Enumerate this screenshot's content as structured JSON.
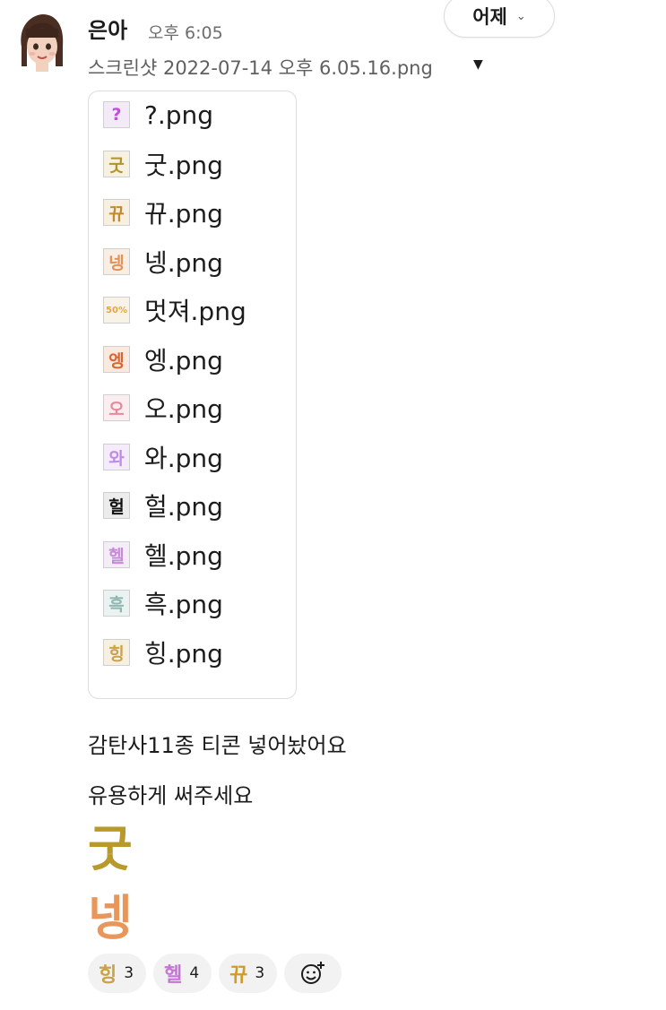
{
  "message": {
    "author": "은아",
    "timestamp": "오후 6:05",
    "date_button": "어제",
    "file_name": "스크린샷 2022-07-14 오후 6.05.16.png",
    "lines": [
      "감탄사11종 티콘 넣어놨어요",
      "유용하게 써주세요"
    ]
  },
  "files": [
    {
      "icon": "?",
      "label": "?.png",
      "color": "#c64be0",
      "bg": "#f2eaf7"
    },
    {
      "icon": "굿",
      "label": "굿.png",
      "color": "#b4922a",
      "bg": "#f6f1e0"
    },
    {
      "icon": "뀨",
      "label": "뀨.png",
      "color": "#c2892e",
      "bg": "#f7efe0"
    },
    {
      "icon": "넹",
      "label": "넹.png",
      "color": "#e0945a",
      "bg": "#f9eee4"
    },
    {
      "icon": "50%",
      "label": "멋져.png",
      "color": "#e2a64a",
      "bg": "#f8f3e6"
    },
    {
      "icon": "엥",
      "label": "엥.png",
      "color": "#d9662e",
      "bg": "#f9e9df"
    },
    {
      "icon": "오",
      "label": "오.png",
      "color": "#e58a9a",
      "bg": "#fbeef0"
    },
    {
      "icon": "와",
      "label": "와.png",
      "color": "#c08ae8",
      "bg": "#f4ecfb"
    },
    {
      "icon": "헐",
      "label": "헐.png",
      "color": "#111111",
      "bg": "#ececec"
    },
    {
      "icon": "헬",
      "label": "헬.png",
      "color": "#c68ad8",
      "bg": "#f4ecf7"
    },
    {
      "icon": "흑",
      "label": "흑.png",
      "color": "#8fb6b0",
      "bg": "#ebf3f2"
    },
    {
      "icon": "힝",
      "label": "힝.png",
      "color": "#c9a24a",
      "bg": "#f6f0e2"
    }
  ],
  "big_emojis": [
    {
      "text": "굿",
      "color": "#b89a2a"
    },
    {
      "text": "넹",
      "color": "#e8965a"
    }
  ],
  "reactions": [
    {
      "emoji": "힝",
      "count": "3",
      "color": "#c9a24a"
    },
    {
      "emoji": "헬",
      "count": "4",
      "color": "#c774d8"
    },
    {
      "emoji": "뀨",
      "count": "3",
      "color": "#d09a2c"
    }
  ],
  "add_reaction_icon": "add-reaction-icon"
}
